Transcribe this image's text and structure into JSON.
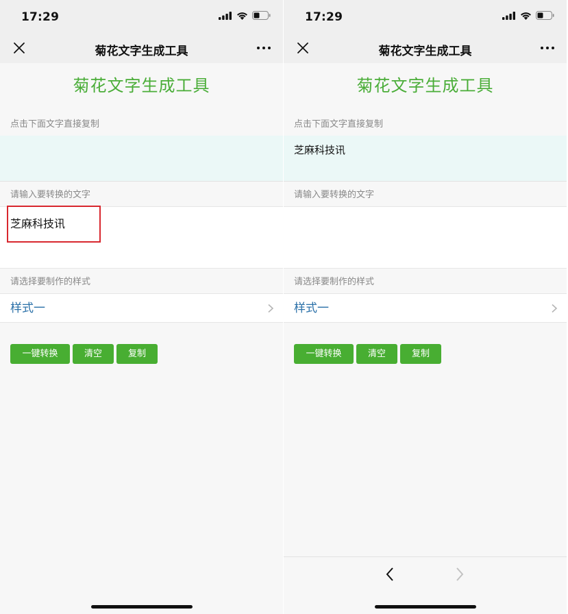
{
  "screens": {
    "left": {
      "status_time": "17:29",
      "nav_title": "菊花文字生成工具",
      "page_title": "菊花文字生成工具",
      "output_label": "点击下面文字直接复制",
      "output_text": "",
      "input_label": "请输入要转换的文字",
      "input_value": "芝麻科技讯",
      "style_label": "请选择要制作的样式",
      "style_value": "样式一",
      "buttons": {
        "convert": "一键转换",
        "clear": "清空",
        "copy": "复制"
      }
    },
    "right": {
      "status_time": "17:29",
      "nav_title": "菊花文字生成工具",
      "page_title": "菊花文字生成工具",
      "output_label": "点击下面文字直接复制",
      "output_text": "芝麻科技讯",
      "input_label": "请输入要转换的文字",
      "input_value": "",
      "style_label": "请选择要制作的样式",
      "style_value": "样式一",
      "buttons": {
        "convert": "一键转换",
        "clear": "清空",
        "copy": "复制"
      }
    }
  },
  "colors": {
    "accent_green": "#4aad38",
    "button_green": "#48ae32",
    "link_blue": "#2a70a8",
    "highlight_red": "#d8262d",
    "output_bg": "#ebf8f7"
  },
  "icons": [
    "close-icon",
    "more-icon",
    "signal-icon",
    "wifi-icon",
    "battery-icon",
    "chevron-right-icon",
    "back-arrow-icon",
    "forward-arrow-icon"
  ]
}
